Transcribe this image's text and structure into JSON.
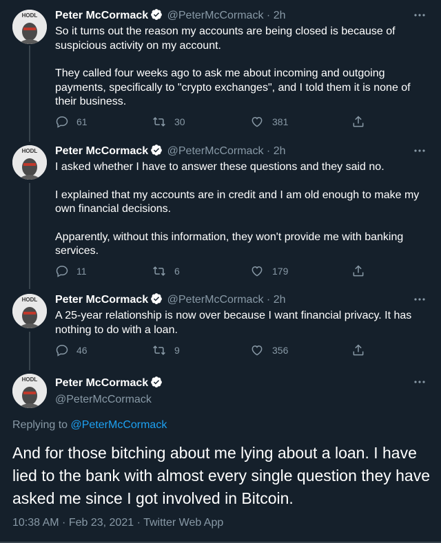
{
  "author": {
    "name": "Peter McCormack",
    "handle": "@PeterMcCormack",
    "avatar_text": "HODL"
  },
  "tweets": [
    {
      "time": "2h",
      "paragraphs": [
        "So it turns out the reason my accounts are being closed is because of suspicious activity on my account.",
        "They called four weeks ago to ask me about incoming and outgoing payments, specifically to \"crypto exchanges\", and I told them it is none of their business."
      ],
      "replies": "61",
      "retweets": "30",
      "likes": "381"
    },
    {
      "time": "2h",
      "paragraphs": [
        "I asked whether I have to answer these questions and they said no.",
        "I explained that my accounts are in credit and I am old enough to make my own financial decisions.",
        "Apparently, without this information, they won't provide me with banking services."
      ],
      "replies": "11",
      "retweets": "6",
      "likes": "179"
    },
    {
      "time": "2h",
      "paragraphs": [
        "A 25-year relationship is now over because I want financial privacy. It has nothing to do with a loan."
      ],
      "replies": "46",
      "retweets": "9",
      "likes": "356"
    }
  ],
  "main_tweet": {
    "replying_to_label": "Replying to",
    "replying_to_handle": "@PeterMcCormack",
    "text": "And for those bitching about me lying about a loan. I have lied to the bank with almost every single question they have asked me since I got involved in Bitcoin.",
    "timestamp": "10:38 AM · Feb 23, 2021",
    "separator": "·",
    "source": "Twitter Web App"
  },
  "colors": {
    "background": "#15202b",
    "text": "#ffffff",
    "muted": "#8899a6",
    "link": "#1da1f2",
    "verified": "#ffffff",
    "divider": "#38444d"
  },
  "icons": {
    "verified": "verified-badge-icon",
    "more": "more-dots-icon",
    "reply": "reply-icon",
    "retweet": "retweet-icon",
    "like": "heart-icon",
    "share": "share-icon"
  }
}
